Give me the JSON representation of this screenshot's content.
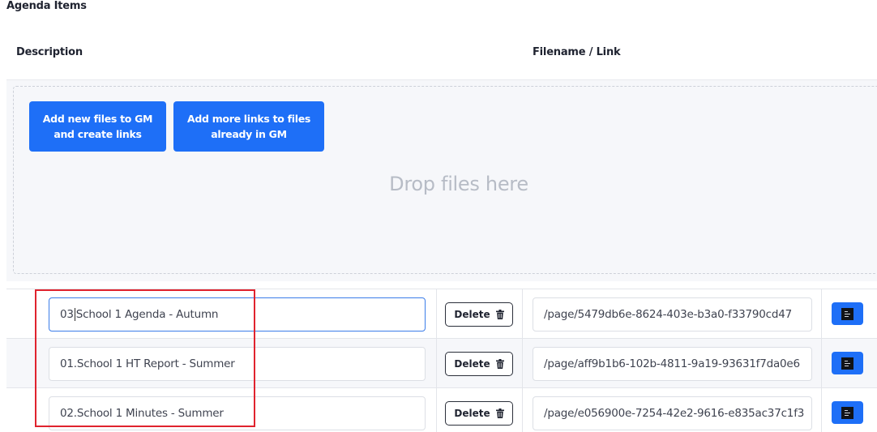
{
  "section": {
    "title": "Agenda Items"
  },
  "columns": {
    "description": "Description",
    "filename": "Filename / Link"
  },
  "dropzone": {
    "add_new_label": "Add new files to GM and create links",
    "add_more_label": "Add more links to files already in GM",
    "drop_text": "Drop files here"
  },
  "rows": [
    {
      "description": "03School 1 Agenda - Autumn",
      "description_prefix": "03",
      "description_rest": "School 1 Agenda - Autumn",
      "delete_label": "Delete",
      "link": "/page/5479db6e-8624-403e-b3a0-f33790cd47",
      "focused": true
    },
    {
      "description": "01.School 1 HT Report - Summer",
      "delete_label": "Delete",
      "link": "/page/aff9b1b6-102b-4811-9a19-93631f7da0e6"
    },
    {
      "description": "02.School 1 Minutes - Summer",
      "delete_label": "Delete",
      "link": "/page/e056900e-7254-42e2-9616-e835ac37c1f3"
    }
  ],
  "colors": {
    "accent": "#1e6ff7",
    "highlight": "#e0232e",
    "focus_border": "#3b7de9"
  },
  "icons": {
    "delete": "trash-icon",
    "thumbnail": "document-thumbnail-icon"
  }
}
